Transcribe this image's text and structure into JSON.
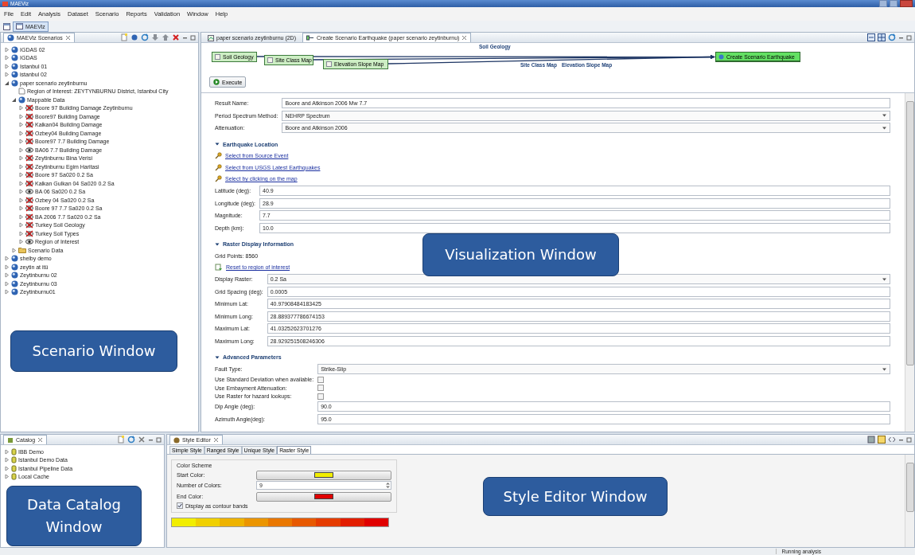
{
  "window": {
    "title": "MAEViz"
  },
  "menu": [
    "File",
    "Edit",
    "Analysis",
    "Dataset",
    "Scenario",
    "Reports",
    "Validation",
    "Window",
    "Help"
  ],
  "perspective": {
    "label": "MAEViz",
    "selected": true
  },
  "scenarios_view": {
    "title": "MAEViz Scenarios",
    "callout": "Scenario Window",
    "tree": [
      {
        "label": "IGDAS 02",
        "kind": "scenario",
        "expanded": false
      },
      {
        "label": "IGDAS",
        "kind": "scenario",
        "expanded": false
      },
      {
        "label": "Istanbul 01",
        "kind": "scenario",
        "expanded": false
      },
      {
        "label": "istanbul 02",
        "kind": "scenario",
        "expanded": false
      },
      {
        "label": "paper scenario zeytinburnu",
        "kind": "scenario",
        "expanded": true,
        "children": [
          {
            "label": "Region of Interest: ZEYTYNBURNU District, Istanbul City",
            "kind": "region"
          },
          {
            "label": "Mappable Data",
            "kind": "layers",
            "expanded": true,
            "children": [
              {
                "label": "Boore 97 Building Damage Zeytinburnu",
                "kind": "layer",
                "visible": false,
                "expanded": false
              },
              {
                "label": "Boore97 Building Damage",
                "kind": "layer",
                "visible": false,
                "expanded": false
              },
              {
                "label": "Kalkan04 Building Damage",
                "kind": "layer",
                "visible": false,
                "expanded": false
              },
              {
                "label": "Ozbey04 Building Damage",
                "kind": "layer",
                "visible": false,
                "expanded": false
              },
              {
                "label": "Boore97 7.7 Building Damage",
                "kind": "layer",
                "visible": false,
                "expanded": false
              },
              {
                "label": "BA06 7.7 Building Damage",
                "kind": "layer",
                "visible": true,
                "expanded": false
              },
              {
                "label": "Zeytinburnu Bina Verisi",
                "kind": "layer",
                "visible": false,
                "expanded": false
              },
              {
                "label": "Zeytinburnu Egim Haritasi",
                "kind": "layer",
                "visible": false,
                "expanded": false
              },
              {
                "label": "Boore 97 Sa020 0.2 Sa",
                "kind": "layer",
                "visible": false,
                "expanded": false
              },
              {
                "label": "Kalkan Gulkan 04 Sa020 0.2 Sa",
                "kind": "layer",
                "visible": false,
                "expanded": false
              },
              {
                "label": "BA 06 Sa020 0.2 Sa",
                "kind": "layer",
                "visible": true,
                "expanded": false
              },
              {
                "label": "Ozbey 04 Sa020 0.2 Sa",
                "kind": "layer",
                "visible": false,
                "expanded": false
              },
              {
                "label": "Boore 97 7.7 Sa020 0.2 Sa",
                "kind": "layer",
                "visible": false,
                "expanded": false
              },
              {
                "label": "BA 2006 7.7 Sa020 0.2 Sa",
                "kind": "layer",
                "visible": false,
                "expanded": false
              },
              {
                "label": "Turkey Soil Geology",
                "kind": "layer",
                "visible": false,
                "expanded": false
              },
              {
                "label": "Turkey Soil Types",
                "kind": "layer",
                "visible": false,
                "expanded": false
              },
              {
                "label": "Region of Interest",
                "kind": "layer",
                "visible": true,
                "expanded": false
              }
            ]
          },
          {
            "label": "Scenario Data",
            "kind": "folder",
            "expanded": false
          }
        ]
      },
      {
        "label": "shelby demo",
        "kind": "scenario",
        "expanded": false
      },
      {
        "label": "zeytin at itü",
        "kind": "scenario",
        "expanded": false
      },
      {
        "label": "Zeytinburnu 02",
        "kind": "scenario",
        "expanded": false
      },
      {
        "label": "Zeytinburnu 03",
        "kind": "scenario",
        "expanded": false
      },
      {
        "label": "Zeytinburnu01",
        "kind": "scenario",
        "expanded": false
      }
    ]
  },
  "editor": {
    "callout": "Visualization Window",
    "tabs": [
      {
        "label": "paper scenario zeytinburnu (2D)",
        "selected": false
      },
      {
        "label": "Create Scenario Earthquake (paper scenario zeytinburnu)",
        "selected": true
      }
    ],
    "workflow": {
      "nodes": [
        {
          "label": "Soil Geology",
          "kind": "input"
        },
        {
          "label": "Site Class Map",
          "kind": "input"
        },
        {
          "label": "Elevation Slope Map",
          "kind": "input"
        },
        {
          "label": "Create Scenario Earthquake",
          "kind": "analysis"
        }
      ],
      "edge_labels": [
        "Soil Geology",
        "Site Class Map",
        "Elevation Slope Map"
      ]
    },
    "execute": {
      "label": "Execute"
    },
    "groups": [
      {
        "rows": [
          {
            "kind": "text",
            "label": "Result Name:",
            "value": "Boore and Atkinson 2006 Mw 7.7"
          },
          {
            "kind": "combo",
            "label": "Period Spectrum Method:",
            "value": "NEHRP Spectrum"
          },
          {
            "kind": "combo",
            "label": "Attenuation:",
            "value": "Boore and Atkinson 2006"
          }
        ]
      },
      {
        "title": "Earthquake Location",
        "expanded": true,
        "rows": [
          {
            "kind": "link",
            "label": "Select from Source Event"
          },
          {
            "kind": "link",
            "label": "Select from USGS Latest Earthquakes"
          },
          {
            "kind": "link",
            "label": "Select by clicking on the map"
          },
          {
            "kind": "text",
            "label": "Latitude (deg):",
            "value": "40.9"
          },
          {
            "kind": "text",
            "label": "Longitude (deg):",
            "value": "28.9"
          },
          {
            "kind": "text",
            "label": "Magnitude:",
            "value": "7.7"
          },
          {
            "kind": "text",
            "label": "Depth (km):",
            "value": "10.0"
          }
        ]
      },
      {
        "title": "Raster Display Information",
        "expanded": true,
        "rows": [
          {
            "kind": "info",
            "label": "Grid Points: 8560"
          },
          {
            "kind": "reset_link",
            "label": "Reset to region of interest"
          },
          {
            "kind": "combo",
            "label": "Display Raster:",
            "value": "0.2 Sa"
          },
          {
            "kind": "text",
            "label": "Grid Spacing (deg):",
            "value": "0.0005"
          },
          {
            "kind": "text",
            "label": "Minimum Lat:",
            "value": "40.97908484183425"
          },
          {
            "kind": "text",
            "label": "Minimum Long:",
            "value": "28.889377786674153"
          },
          {
            "kind": "text",
            "label": "Maximum Lat:",
            "value": "41.03252623701276"
          },
          {
            "kind": "text",
            "label": "Maximum Long:",
            "value": "28.929251508246306"
          }
        ]
      },
      {
        "title": "Advanced Parameters",
        "expanded": true,
        "rows": [
          {
            "kind": "combo",
            "label": "Fault Type:",
            "value": "Strike-Slip"
          },
          {
            "kind": "checkbox",
            "label": "Use Standard Deviation when available:",
            "checked": false
          },
          {
            "kind": "checkbox",
            "label": "Use Embayment Attenuation:",
            "checked": false
          },
          {
            "kind": "checkbox",
            "label": "Use Raster for hazard lookups:",
            "checked": false
          },
          {
            "kind": "text",
            "label": "Dip Angle (deg):",
            "value": "90.0"
          },
          {
            "kind": "text",
            "label": "Azimuth Angle(deg):",
            "value": "95.0"
          }
        ]
      }
    ]
  },
  "catalog": {
    "title": "Catalog",
    "callout": "Data Catalog Window",
    "tree": [
      {
        "label": "IBB Demo",
        "kind": "dataset",
        "expanded": false
      },
      {
        "label": "Istanbul Demo Data",
        "kind": "dataset",
        "expanded": false
      },
      {
        "label": "Istanbul Pipeline Data",
        "kind": "dataset",
        "expanded": false
      },
      {
        "label": "Local Cache",
        "kind": "dataset",
        "expanded": false
      }
    ]
  },
  "style_editor": {
    "title": "Style Editor",
    "callout": "Style Editor Window",
    "tabs": [
      {
        "label": "Simple Style",
        "selected": false
      },
      {
        "label": "Ranged Style",
        "selected": false
      },
      {
        "label": "Unique Style",
        "selected": false
      },
      {
        "label": "Raster Style",
        "selected": true
      }
    ],
    "group_title": "Color Scheme",
    "rows": [
      {
        "kind": "color",
        "label": "Start Color:",
        "color": "#f2ee00"
      },
      {
        "kind": "spinner",
        "label": "Number of Colors:",
        "value": "9"
      },
      {
        "kind": "color",
        "label": "End Color:",
        "color": "#e00000"
      },
      {
        "kind": "checkbox",
        "label": "Display as contour bands",
        "checked": true
      }
    ]
  },
  "status_bar": {
    "message": "Running analysis"
  }
}
